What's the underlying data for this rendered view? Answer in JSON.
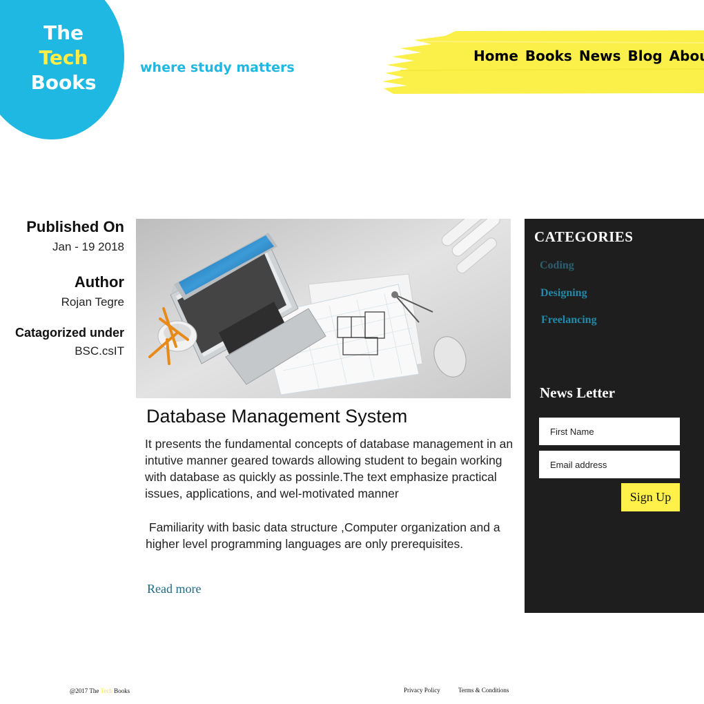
{
  "brand": {
    "logo_line1": "The",
    "logo_line2": "Tech",
    "logo_line3": "Books",
    "tagline": "where study matters",
    "circle_color": "#1eb8e2",
    "highlight_color": "#ffee48"
  },
  "nav": {
    "items": [
      "Home",
      "Books",
      "News",
      "Blog",
      "About"
    ]
  },
  "meta": {
    "published_label": "Published On",
    "published_value": "Jan - 19 2018",
    "author_label": "Author",
    "author_value": "Rojan Tegre",
    "category_label": "Catagorized under",
    "category_value": "BSC.csIT"
  },
  "article": {
    "image": "laptop-blueprint-image",
    "title": "Database Management System",
    "paragraph1": "It presents the fundamental concepts of database management in an intutive manner geared towards allowing student to begain working with database as quickly as possinle.The text emphasize practical issues, applications, and wel-motivated manner",
    "paragraph2": " Familiarity with basic data structure ,Computer organization and a higher level programming languages are only prerequisites.",
    "read_more": "Read more"
  },
  "sidebar": {
    "categories_title": "CATEGORIES",
    "categories": [
      "Coding",
      "Designing",
      "Freelancing"
    ],
    "newsletter_title": "News Letter",
    "first_name_placeholder": "First Name",
    "email_placeholder": "Email address",
    "signup_label": "Sign Up",
    "background": "#1e1e1e",
    "button_color": "#fff04a"
  },
  "footer": {
    "copyright_prefix": "@2017 The",
    "copyright_highlight": "Tech",
    "copyright_suffix": "Books",
    "links": [
      "Privacy Policy",
      "Terms & Conditions"
    ]
  }
}
